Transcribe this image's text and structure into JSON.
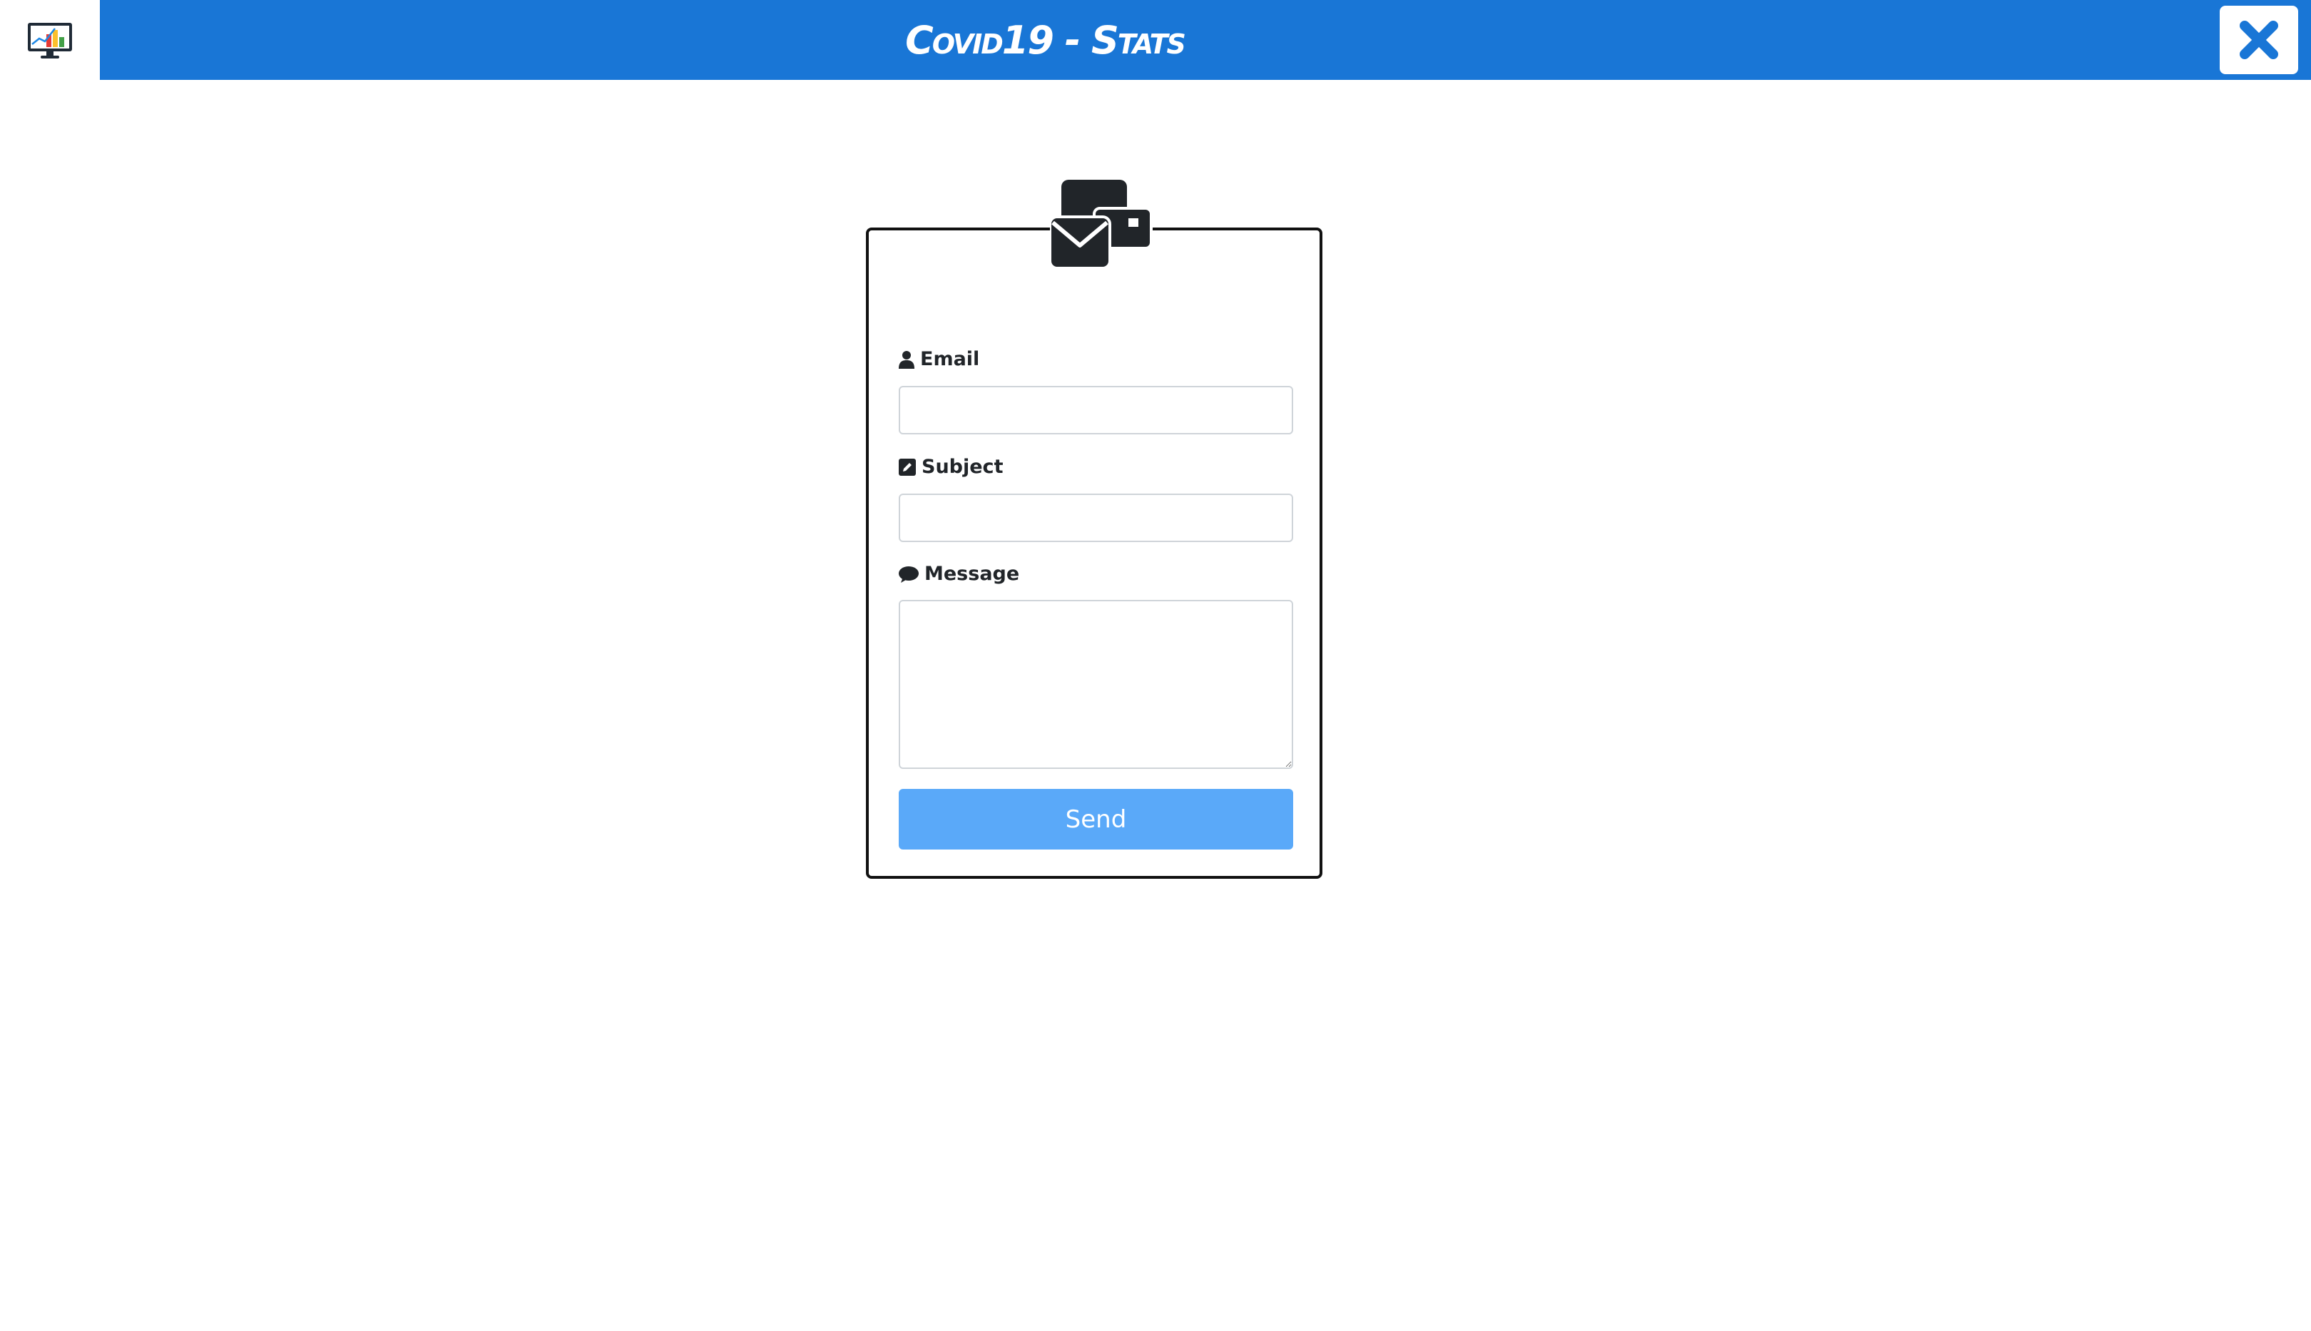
{
  "header": {
    "title": "Covid19 - Stats",
    "logo_icon": "monitor-chart-icon",
    "close_icon": "close-icon",
    "brand_color": "#1976d6"
  },
  "contact_form": {
    "header_icon": "envelopes-icon",
    "email": {
      "label": "Email",
      "icon": "user-icon",
      "value": "",
      "placeholder": ""
    },
    "subject": {
      "label": "Subject",
      "icon": "edit-icon",
      "value": "",
      "placeholder": ""
    },
    "message": {
      "label": "Message",
      "icon": "comment-icon",
      "value": "",
      "placeholder": ""
    },
    "send_label": "Send",
    "send_color": "#5aa9f9"
  }
}
